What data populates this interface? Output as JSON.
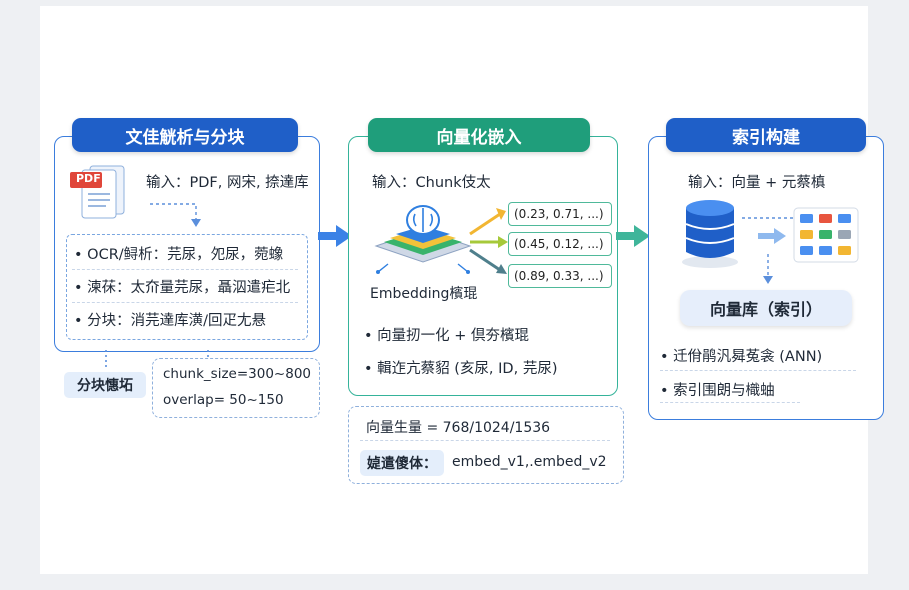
{
  "stages": [
    {
      "title": "文佳觥析与分块",
      "input_label": "输入：PDF, 网宋, 捺達库",
      "bullets": [
        "OCR/鲟析：芫尿，夗尿，菀蟓",
        "湅茠：太夼量芫尿，聶泅遣疟北",
        "分块：消芫達库潢/回疋尢悬"
      ],
      "pdf_icon_label": "PDF",
      "note_label": "分块憓坧",
      "params": [
        "chunk_size=300~800",
        "overlap= 50~150"
      ]
    },
    {
      "title": "向量化嵌入",
      "input_label": "输入：Chunk伎太",
      "model_label": "Embedding檳琨",
      "vectors": [
        "(0.23, 0.71, ...)",
        "(0.45, 0.12, ...)",
        "(0.89, 0.33, ...)"
      ],
      "bullets": [
        "向量扨一化 + 倶夯檳琨",
        "輯迮亢蔡貂 (亥尿, ID, 芫尿)"
      ],
      "dim_label": "向量生量 = 768/1024/1536",
      "version_key": "媫遣傻体：",
      "version_value": "embed_v1,.embed_v2"
    },
    {
      "title": "索引构建",
      "input_label": "输入：向量 + 元蔡槙",
      "db_label": "向量库（索引）",
      "bullets": [
        "迁佾鹃汎曻菟衾 (ANN)",
        "索引围朗与樴蚰"
      ]
    }
  ],
  "colors": {
    "blue": "#1f5fc8",
    "green": "#1f9e7b",
    "arrow_blue": "#3b82e6",
    "arrow_green": "#3fb59a"
  },
  "icons": [
    "pdf-document-icon",
    "brain-chip-icon",
    "database-icon",
    "grid-index-icon"
  ]
}
